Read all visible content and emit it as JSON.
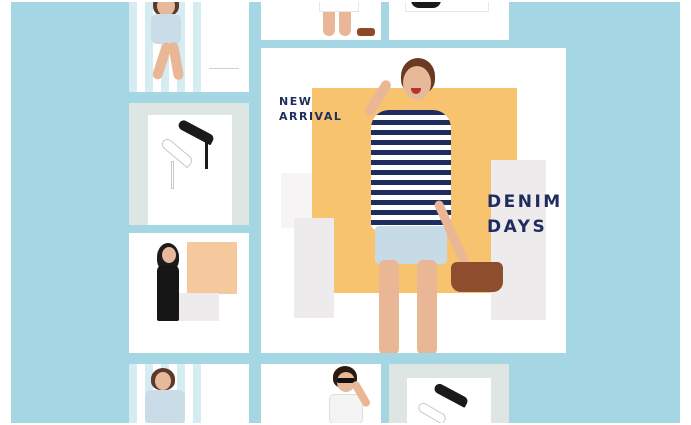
{
  "post": {
    "tagline_line1": "NEW",
    "tagline_line2": "ARRIVAL",
    "headline_line1": "DENIM",
    "headline_line2": "DAYS"
  },
  "colors": {
    "background": "#a5d6e3",
    "accent_orange": "#f7c36e",
    "text_navy": "#1f2c5e",
    "peach": "#f6c89e",
    "sage": "#dde6e3"
  }
}
